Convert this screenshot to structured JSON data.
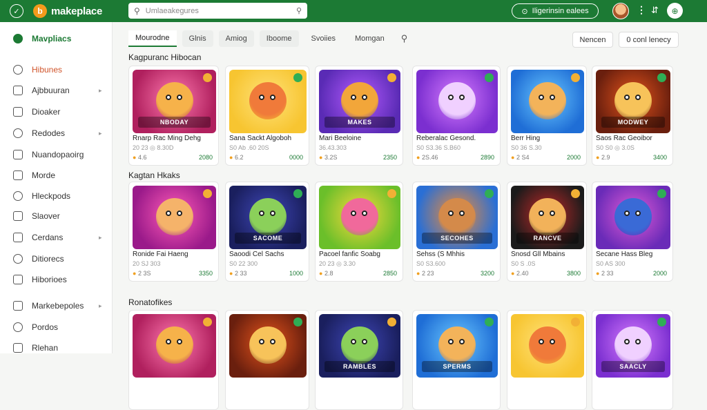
{
  "app": {
    "title": "makeplace"
  },
  "topbar": {
    "search_placeholder": "Umlaeakegures",
    "cta_label": "Iligerinsin ealees",
    "kebab": "⋮",
    "tb_icon": "⇵"
  },
  "sidebar": {
    "items": [
      {
        "label": "Mavpliacs",
        "icon": "store-icon",
        "active": true
      },
      {
        "label": "Hibunes",
        "icon": "tag-icon",
        "highlight": true
      },
      {
        "label": "Ajbbuuran",
        "icon": "folder-icon",
        "chevron": true
      },
      {
        "label": "Dioaker",
        "icon": "doc-icon"
      },
      {
        "label": "Redodes",
        "icon": "grid-icon",
        "chevron": true
      },
      {
        "label": "Nuandopaoirg",
        "icon": "clock-icon"
      },
      {
        "label": "Morde",
        "icon": "box-icon"
      },
      {
        "label": "Hleckpods",
        "icon": "list-icon"
      },
      {
        "label": "Slaover",
        "icon": "search-icon"
      },
      {
        "label": "Cerdans",
        "icon": "chat-icon",
        "chevron": true
      },
      {
        "label": "Ditiorecs",
        "icon": "settings-icon"
      },
      {
        "label": "Hiborioes",
        "icon": "info-icon"
      },
      {
        "label": "Markebepoles",
        "icon": "cart-icon",
        "chevron": true
      },
      {
        "label": "Pordos",
        "icon": "user-icon"
      },
      {
        "label": "Rlehan",
        "icon": "bag-icon"
      }
    ]
  },
  "tabs": {
    "items": [
      "Mourodne",
      "Glnis",
      "Amiog",
      "Iboome",
      "Svoiies",
      "Momgan"
    ],
    "active": 0,
    "btn_filter": "Nencen",
    "btn_sort": "0 conl lenecy"
  },
  "sections": [
    {
      "title": "Kagpuranc Hibocan",
      "cards": [
        {
          "name": "Rnarp Rac Ming Dehg",
          "sub": "20 23 ◎ 8.30D",
          "rating": "4.6",
          "price": "2080",
          "theme": "pink",
          "label": "NBODAY"
        },
        {
          "name": "Sana Sackt Algoboh",
          "sub": "S0 Ab .60 20S",
          "rating": "6.2",
          "price": "0000",
          "theme": "yellow",
          "label": ""
        },
        {
          "name": "Mari Beeloine",
          "sub": "36.43.303",
          "rating": "3.2S",
          "price": "2350",
          "theme": "purple",
          "label": "MAKES"
        },
        {
          "name": "Reberalac Gesond.",
          "sub": "S0 S3.36 S.B60",
          "rating": "2S.46",
          "price": "2890",
          "theme": "violet",
          "label": ""
        },
        {
          "name": "Berr Hing",
          "sub": "S0 36 S.30",
          "rating": "2 S4",
          "price": "2000",
          "theme": "blue",
          "label": ""
        },
        {
          "name": "Saos Rac Geoibor",
          "sub": "S0 S0 ◎ 3.0S",
          "rating": "2.9",
          "price": "3400",
          "theme": "orange",
          "label": "MODWEY"
        }
      ]
    },
    {
      "title": "Kagtan Hkaks",
      "cards": [
        {
          "name": "Ronide Fai Haeng",
          "sub": "20 SJ 303",
          "rating": "2 3S",
          "price": "3350",
          "theme": "magenta",
          "label": ""
        },
        {
          "name": "Saoodi Cel Sachs",
          "sub": "S0 22 300",
          "rating": "2 33",
          "price": "1000",
          "theme": "navy",
          "label": "SACOME"
        },
        {
          "name": "Pacoel fanfic Soabg",
          "sub": "20 23 ◎ 3.30",
          "rating": "2.8",
          "price": "2850",
          "theme": "lime",
          "label": ""
        },
        {
          "name": "Sehss (S Mhhis",
          "sub": "S0 S3.600",
          "rating": "2 23",
          "price": "3200",
          "theme": "sky",
          "label": "SECOHES"
        },
        {
          "name": "Snosd Gll Mbains",
          "sub": "S0 S .0S",
          "rating": "2.40",
          "price": "3800",
          "theme": "red",
          "label": "RANCVE"
        },
        {
          "name": "Secane Hass Bleg",
          "sub": "S0 AS 300",
          "rating": "2 33",
          "price": "2000",
          "theme": "purple2",
          "label": ""
        }
      ]
    },
    {
      "title": "Ronatofikes",
      "cards": [
        {
          "name": "",
          "sub": "",
          "rating": "",
          "price": "",
          "theme": "pink",
          "label": ""
        },
        {
          "name": "",
          "sub": "",
          "rating": "",
          "price": "",
          "theme": "orange",
          "label": ""
        },
        {
          "name": "",
          "sub": "",
          "rating": "",
          "price": "",
          "theme": "navy",
          "label": "RAMBLES"
        },
        {
          "name": "",
          "sub": "",
          "rating": "",
          "price": "",
          "theme": "blue",
          "label": "SPERMS"
        },
        {
          "name": "",
          "sub": "",
          "rating": "",
          "price": "",
          "theme": "yellow",
          "label": ""
        },
        {
          "name": "",
          "sub": "",
          "rating": "",
          "price": "",
          "theme": "violet",
          "label": "SAACLY"
        }
      ]
    }
  ],
  "themes": {
    "pink": [
      "#b0205e",
      "#ff7ab0",
      "#f6b24a"
    ],
    "yellow": [
      "#f7c531",
      "#ffe27a",
      "#f07a3a"
    ],
    "purple": [
      "#5a2bb5",
      "#b45bff",
      "#f2a63a"
    ],
    "violet": [
      "#7b2fd0",
      "#d77cff",
      "#f0d0ff"
    ],
    "blue": [
      "#1f6ed6",
      "#6ac8ff",
      "#f3b35a"
    ],
    "orange": [
      "#6a1f0e",
      "#e5541c",
      "#f7c35a"
    ],
    "magenta": [
      "#9a1a8a",
      "#ff5bb7",
      "#f5b36a"
    ],
    "navy": [
      "#1a1f5e",
      "#3f47b8",
      "#8bd05a"
    ],
    "lime": [
      "#6bbf2a",
      "#f7d93c",
      "#f0699b"
    ],
    "sky": [
      "#2a6fd5",
      "#f28c33",
      "#d48a4a"
    ],
    "red": [
      "#1b1b1b",
      "#c22828",
      "#f2b25a"
    ],
    "purple2": [
      "#6a2bb8",
      "#e05bd6",
      "#3a6ad6"
    ]
  },
  "colors": {
    "brand": "#1c7a34",
    "accent": "#f39a1c"
  }
}
